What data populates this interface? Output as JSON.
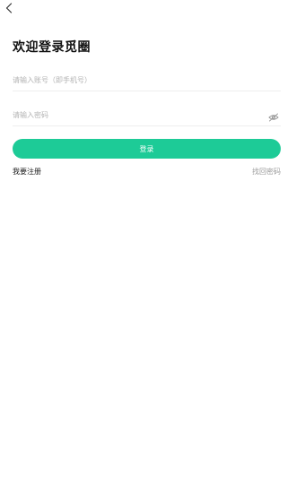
{
  "header": {
    "back_icon": "chevron-left-icon"
  },
  "title": "欢迎登录觅圈",
  "account": {
    "placeholder": "请输入账号（即手机号）",
    "value": ""
  },
  "password": {
    "placeholder": "请输入密码",
    "value": "",
    "toggle_icon": "eye-slash-icon"
  },
  "login_button": "登录",
  "register_link": "我要注册",
  "forgot_link": "找回密码",
  "colors": {
    "accent": "#1dcb97",
    "divider": "#eeeeee",
    "placeholder": "#b3b3b3",
    "muted_link": "#9a9a9a"
  }
}
